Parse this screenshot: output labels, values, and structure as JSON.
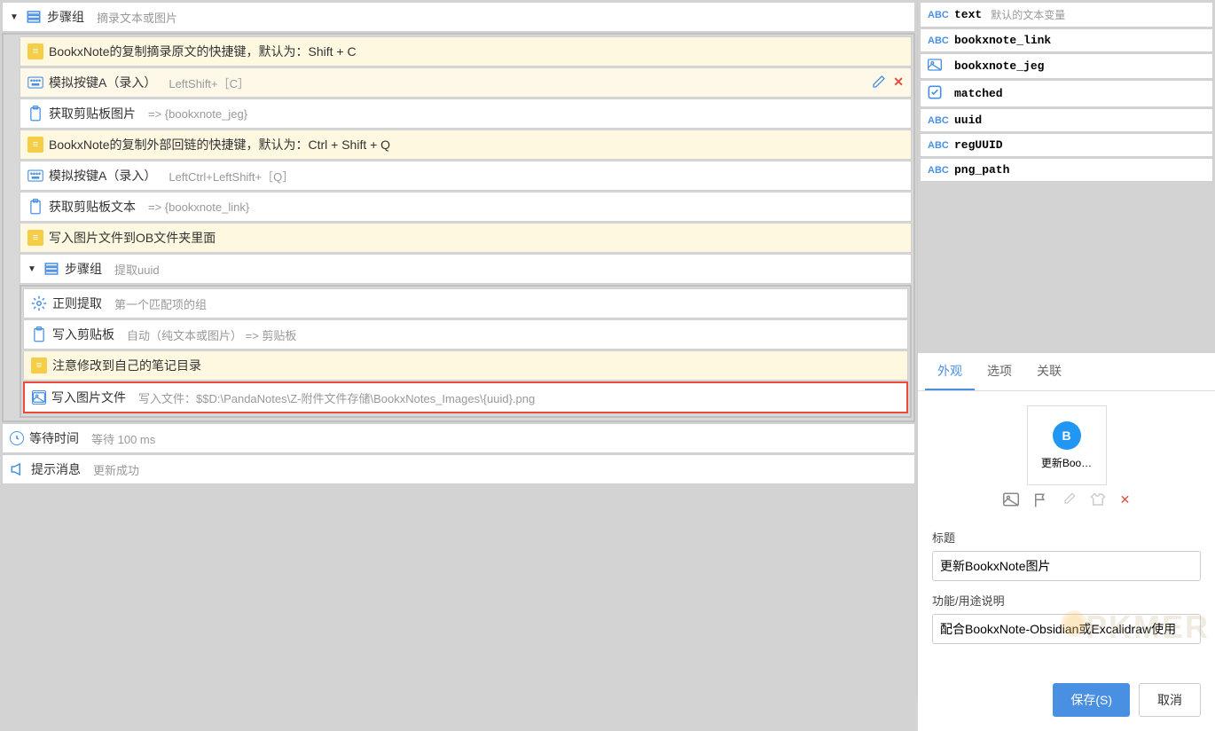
{
  "steps": {
    "group_label": "步骤组",
    "group_sub": "摘录文本或图片",
    "rows": [
      {
        "type": "note",
        "label": "BookxNote的复制摘录原文的快捷键，默认为：Shift + C"
      },
      {
        "type": "kbd",
        "label": "模拟按键A（录入）",
        "sub": "LeftShift+［C］",
        "selected": true
      },
      {
        "type": "clip",
        "label": "获取剪贴板图片",
        "sub": "=> {bookxnote_jeg}"
      },
      {
        "type": "note",
        "label": "BookxNote的复制外部回链的快捷键，默认为：Ctrl + Shift + Q"
      },
      {
        "type": "kbd",
        "label": "模拟按键A（录入）",
        "sub": "LeftCtrl+LeftShift+［Q］"
      },
      {
        "type": "clip",
        "label": "获取剪贴板文本",
        "sub": "=> {bookxnote_link}"
      },
      {
        "type": "note",
        "label": "写入图片文件到OB文件夹里面"
      }
    ],
    "group2_label": "步骤组",
    "group2_sub": "提取uuid",
    "group2_rows": [
      {
        "type": "gear",
        "label": "正则提取",
        "sub": "第一个匹配项的组"
      },
      {
        "type": "clip",
        "label": "写入剪贴板",
        "sub": "自动（纯文本或图片） => 剪贴板"
      },
      {
        "type": "note",
        "label": "注意修改到自己的笔记目录"
      },
      {
        "type": "img",
        "label": "写入图片文件",
        "sub": "写入文件：$$D:\\PandaNotes\\Z-附件文件存储\\BookxNotes_Images\\{uuid}.png",
        "highlighted": true
      }
    ],
    "wait_label": "等待时间",
    "wait_sub": "等待 100 ms",
    "msg_label": "提示消息",
    "msg_sub": "更新成功"
  },
  "vars": [
    {
      "type": "ABC",
      "name": "text",
      "desc": "默认的文本变量"
    },
    {
      "type": "ABC",
      "name": "bookxnote_link"
    },
    {
      "type": "IMG",
      "name": "bookxnote_jeg"
    },
    {
      "type": "CHK",
      "name": "matched"
    },
    {
      "type": "ABC",
      "name": "uuid"
    },
    {
      "type": "ABC",
      "name": "regUUID"
    },
    {
      "type": "ABC",
      "name": "png_path"
    }
  ],
  "tabs": {
    "t1": "外观",
    "t2": "选项",
    "t3": "关联"
  },
  "props": {
    "thumb_letter": "B",
    "thumb_text": "更新Boo…",
    "title_label": "标题",
    "title_value": "更新BookxNote图片",
    "desc_label": "功能/用途说明",
    "desc_value": "配合BookxNote-Obsidian或Excalidraw使用",
    "watermark": "PKMER"
  },
  "buttons": {
    "save": "保存(S)",
    "cancel": "取消"
  }
}
